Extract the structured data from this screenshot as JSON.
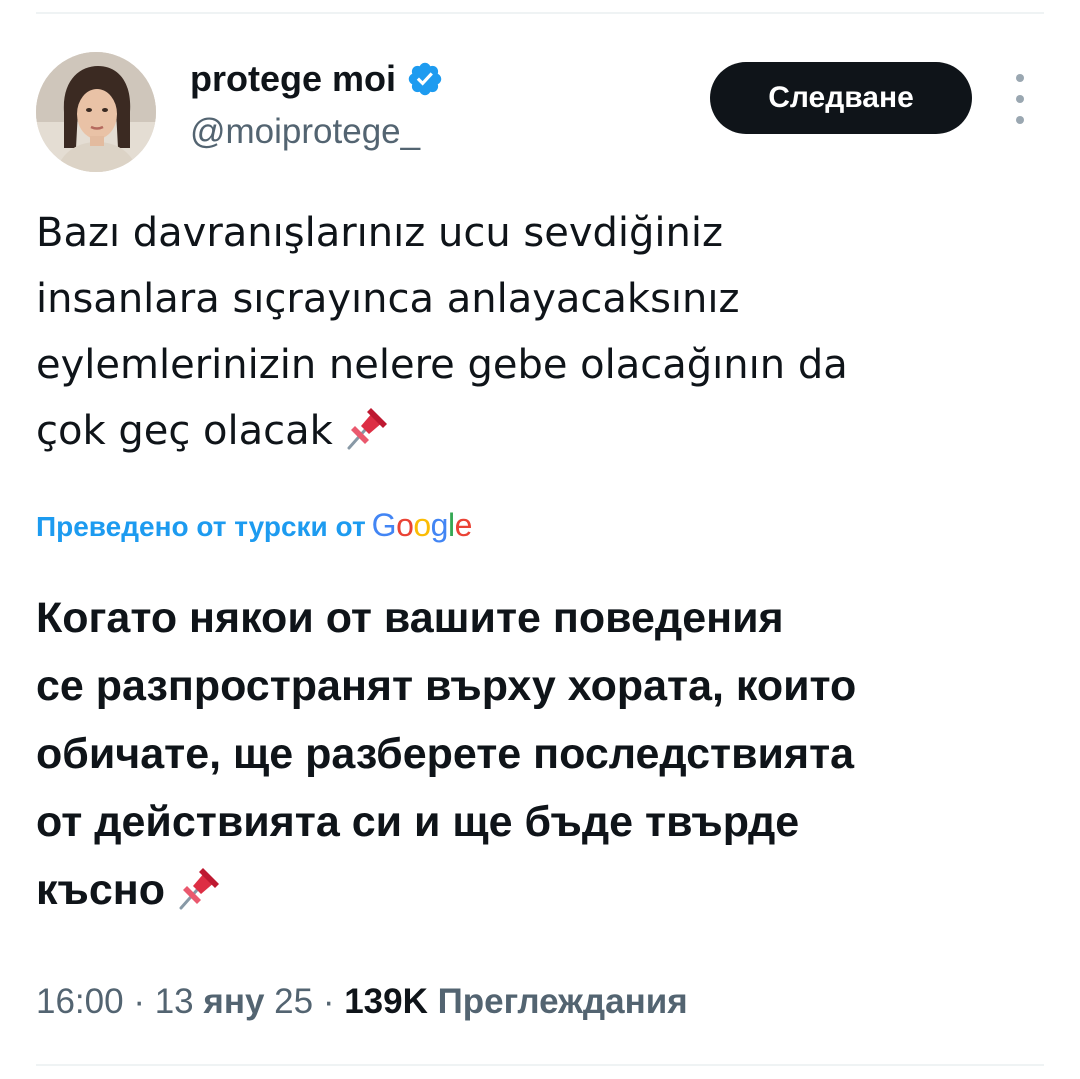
{
  "author": {
    "display_name": "protege moi",
    "handle": "@moiprotege_",
    "verified": true,
    "verified_color": "#1d9bf0"
  },
  "actions": {
    "follow_label": "Следване",
    "more_icon": "more-vertical-icon"
  },
  "tweet": {
    "lines": [
      "Bazı davranışlarınız ucu sevdiğiniz",
      "insanlara sıçrayınca anlayacaksınız",
      "eylemlerinizin nelere gebe olacağının da",
      "çok geç olacak"
    ],
    "emoji": "📌"
  },
  "translation": {
    "label": "Преведено от турски от",
    "provider": "Google",
    "link_color": "#1d9bf0",
    "lines": [
      "Когато някои от вашите поведения",
      "се разпространят върху хората, които",
      "обичате, ще разберете последствията",
      "от действията си и ще бъде твърде",
      "късно"
    ],
    "emoji": "📌"
  },
  "meta": {
    "time": "16:00",
    "separator": "·",
    "date_day": "13",
    "date_month": "яну",
    "date_year": "25",
    "views_count": "139K",
    "views_label": "Преглеждания"
  }
}
